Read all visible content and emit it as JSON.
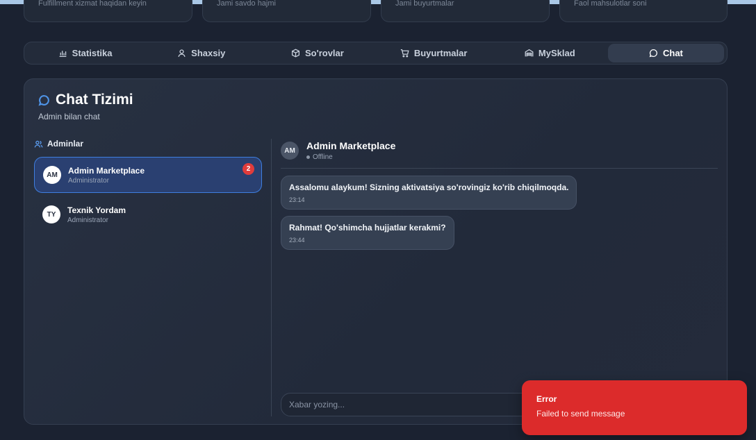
{
  "colors": {
    "background": "#1b2231",
    "accent": "#3f7fe0",
    "badge": "#e03c3c",
    "error": "#dc2b2b"
  },
  "stats": [
    {
      "label": "Fulfillment xizmat haqidan keyin"
    },
    {
      "label": "Jami savdo hajmi"
    },
    {
      "label": "Jami buyurtmalar"
    },
    {
      "label": "Faol mahsulotlar soni"
    }
  ],
  "tabs": [
    {
      "label": "Statistika",
      "icon": "bar-chart-icon"
    },
    {
      "label": "Shaxsiy",
      "icon": "user-icon"
    },
    {
      "label": "So'rovlar",
      "icon": "package-icon"
    },
    {
      "label": "Buyurtmalar",
      "icon": "cart-icon"
    },
    {
      "label": "MySklad",
      "icon": "warehouse-icon"
    },
    {
      "label": "Chat",
      "icon": "chat-bubble-icon",
      "active": true
    }
  ],
  "chat_panel": {
    "title": "Chat Tizimi",
    "subtitle": "Admin bilan chat",
    "admins_heading": "Adminlar",
    "admins": [
      {
        "initials": "AM",
        "name": "Admin Marketplace",
        "role": "Administrator",
        "unread": "2",
        "active": true
      },
      {
        "initials": "TY",
        "name": "Texnik Yordam",
        "role": "Administrator",
        "active": false
      }
    ]
  },
  "conversation": {
    "initials": "AM",
    "name": "Admin Marketplace",
    "status": "Offline",
    "messages": [
      {
        "text": "Assalomu alaykum! Sizning aktivatsiya so'rovingiz ko'rib chiqilmoqda.",
        "time": "23:14"
      },
      {
        "text": "Rahmat! Qo'shimcha hujjatlar kerakmi?",
        "time": "23:44"
      }
    ],
    "input_placeholder": "Xabar yozing..."
  },
  "toast": {
    "title": "Error",
    "message": "Failed to send message"
  }
}
